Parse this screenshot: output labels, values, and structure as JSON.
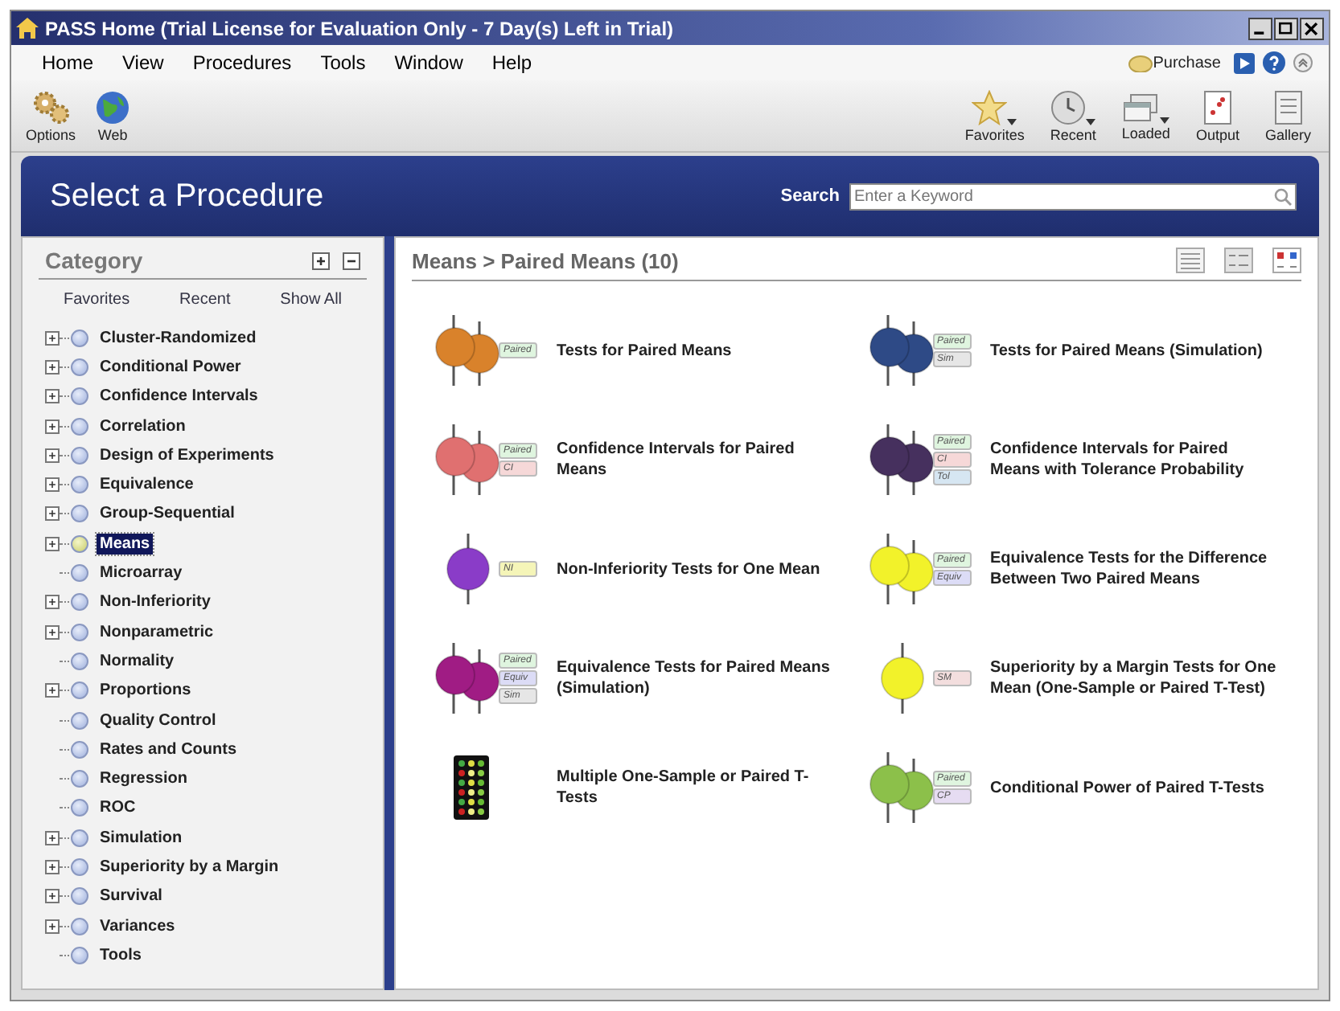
{
  "window": {
    "title": "PASS Home (Trial License for Evaluation Only - 7 Day(s) Left in Trial)"
  },
  "menu": [
    "Home",
    "View",
    "Procedures",
    "Tools",
    "Window",
    "Help"
  ],
  "purchase": "Purchase",
  "toolbar_left": [
    {
      "label": "Options",
      "kind": "gear"
    },
    {
      "label": "Web",
      "kind": "globe"
    }
  ],
  "toolbar_right": [
    {
      "label": "Favorites",
      "kind": "star",
      "dropdown": true
    },
    {
      "label": "Recent",
      "kind": "clock",
      "dropdown": true
    },
    {
      "label": "Loaded",
      "kind": "cards",
      "dropdown": true
    },
    {
      "label": "Output",
      "kind": "output",
      "dropdown": false
    },
    {
      "label": "Gallery",
      "kind": "gallery",
      "dropdown": false
    }
  ],
  "header": {
    "title": "Select a Procedure",
    "search_label": "Search",
    "search_placeholder": "Enter a Keyword"
  },
  "sidebar": {
    "title": "Category",
    "filters": [
      "Favorites",
      "Recent",
      "Show All"
    ],
    "items": [
      {
        "label": "Cluster-Randomized",
        "expandable": true,
        "selected": false
      },
      {
        "label": "Conditional Power",
        "expandable": true,
        "selected": false
      },
      {
        "label": "Confidence Intervals",
        "expandable": true,
        "selected": false
      },
      {
        "label": "Correlation",
        "expandable": true,
        "selected": false
      },
      {
        "label": "Design of Experiments",
        "expandable": true,
        "selected": false
      },
      {
        "label": "Equivalence",
        "expandable": true,
        "selected": false
      },
      {
        "label": "Group-Sequential",
        "expandable": true,
        "selected": false
      },
      {
        "label": "Means",
        "expandable": true,
        "selected": true
      },
      {
        "label": "Microarray",
        "expandable": false,
        "selected": false
      },
      {
        "label": "Non-Inferiority",
        "expandable": true,
        "selected": false
      },
      {
        "label": "Nonparametric",
        "expandable": true,
        "selected": false
      },
      {
        "label": "Normality",
        "expandable": false,
        "selected": false
      },
      {
        "label": "Proportions",
        "expandable": true,
        "selected": false
      },
      {
        "label": "Quality Control",
        "expandable": false,
        "selected": false
      },
      {
        "label": "Rates and Counts",
        "expandable": false,
        "selected": false
      },
      {
        "label": "Regression",
        "expandable": false,
        "selected": false
      },
      {
        "label": "ROC",
        "expandable": false,
        "selected": false
      },
      {
        "label": "Simulation",
        "expandable": true,
        "selected": false
      },
      {
        "label": "Superiority by a Margin",
        "expandable": true,
        "selected": false
      },
      {
        "label": "Survival",
        "expandable": true,
        "selected": false
      },
      {
        "label": "Variances",
        "expandable": true,
        "selected": false
      },
      {
        "label": "Tools",
        "expandable": false,
        "selected": false
      }
    ]
  },
  "content": {
    "breadcrumb": "Means > Paired Means (10)",
    "procedures": [
      {
        "label": "Tests for Paired Means",
        "kind": "paired",
        "color": "#d9822b",
        "tags": [
          "Paired"
        ]
      },
      {
        "label": "Tests for Paired Means (Simulation)",
        "kind": "paired",
        "color": "#2e4a86",
        "tags": [
          "Paired",
          "Sim"
        ]
      },
      {
        "label": "Confidence Intervals for Paired Means",
        "kind": "paired",
        "color": "#e07070",
        "tags": [
          "Paired",
          "CI"
        ]
      },
      {
        "label": "Confidence Intervals for Paired Means with Tolerance Probability",
        "kind": "paired",
        "color": "#46305e",
        "tags": [
          "Paired",
          "CI",
          "Tol"
        ]
      },
      {
        "label": "Non-Inferiority Tests for One Mean",
        "kind": "single",
        "color": "#8a3cc8",
        "tags": [
          "NI"
        ]
      },
      {
        "label": "Equivalence Tests for the Difference Between Two Paired Means",
        "kind": "paired",
        "color": "#f2f22a",
        "tags": [
          "Paired",
          "Equiv"
        ]
      },
      {
        "label": "Equivalence Tests for Paired Means (Simulation)",
        "kind": "paired",
        "color": "#a01c84",
        "tags": [
          "Paired",
          "Equiv",
          "Sim"
        ]
      },
      {
        "label": "Superiority by a Margin Tests for One Mean (One-Sample or Paired T-Test)",
        "kind": "single",
        "color": "#f2f22a",
        "tags": [
          "SM"
        ]
      },
      {
        "label": "Multiple One-Sample or Paired T-Tests",
        "kind": "grid",
        "color": "#111111"
      },
      {
        "label": "Conditional Power of Paired T-Tests",
        "kind": "paired",
        "color": "#8cc04a",
        "tags": [
          "Paired",
          "CP"
        ]
      }
    ]
  }
}
